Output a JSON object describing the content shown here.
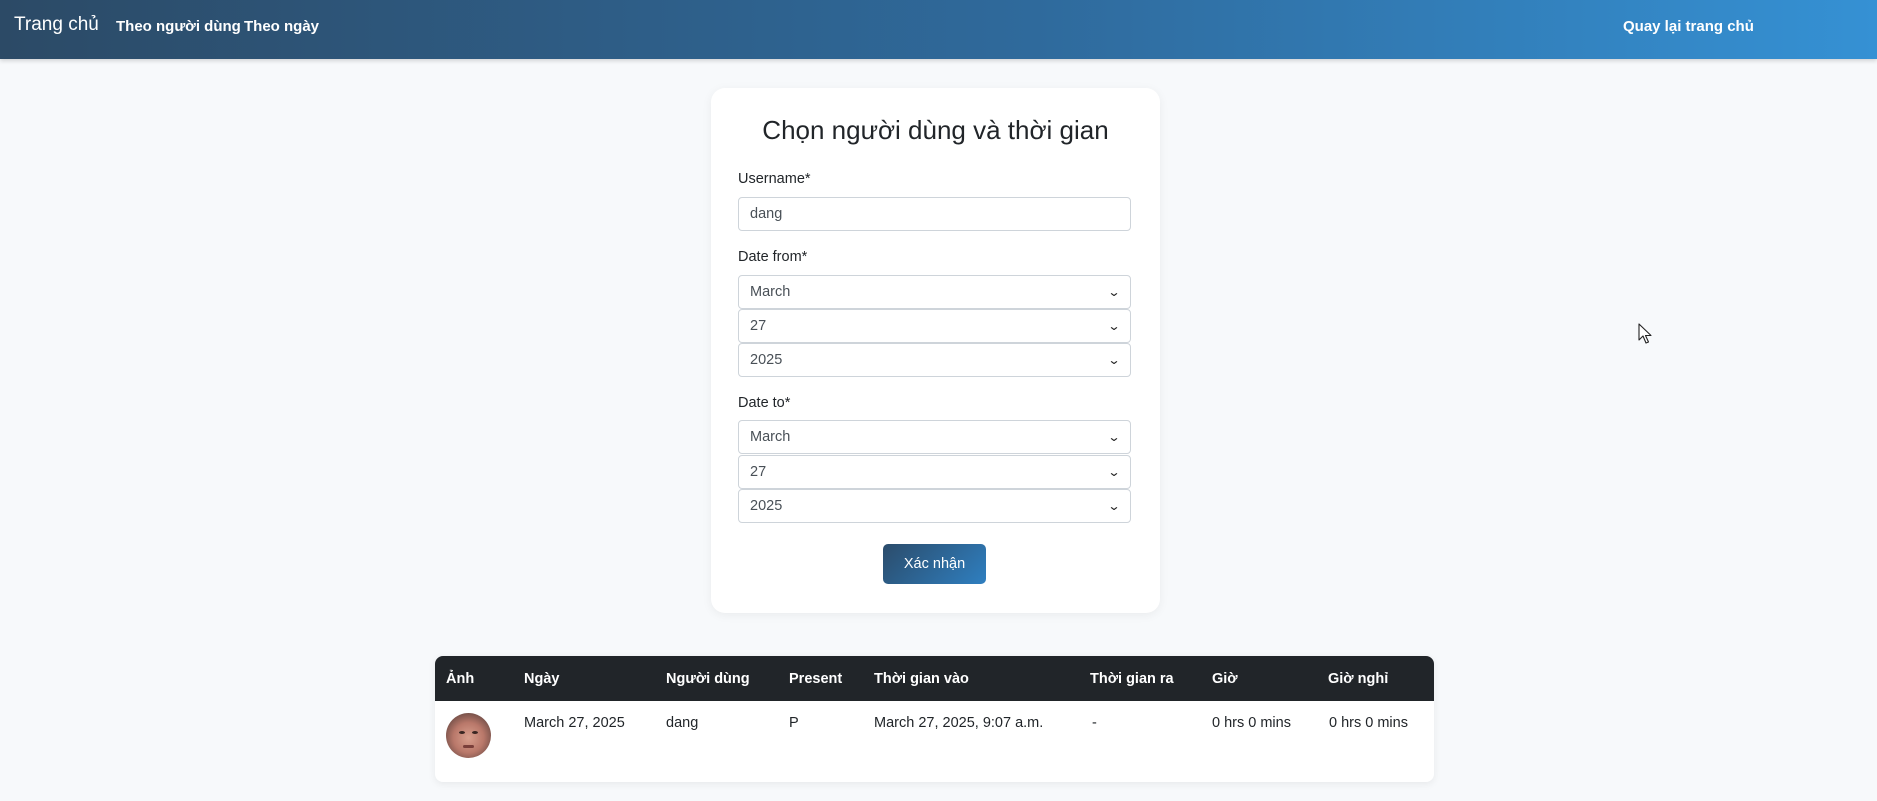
{
  "navbar": {
    "brand": "Trang chủ",
    "links": [
      "Theo người dùng",
      "Theo ngày"
    ],
    "back": "Quay lại trang chủ"
  },
  "form": {
    "title": "Chọn người dùng và thời gian",
    "username_label": "Username*",
    "username_value": "dang",
    "date_from_label": "Date from*",
    "date_from": {
      "month": "March",
      "day": "27",
      "year": "2025"
    },
    "date_to_label": "Date to*",
    "date_to": {
      "month": "March",
      "day": "27",
      "year": "2025"
    },
    "submit": "Xác nhận"
  },
  "table": {
    "headers": [
      "Ảnh",
      "Ngày",
      "Người dùng",
      "Present",
      "Thời gian vào",
      "Thời gian ra",
      "Giờ",
      "Giờ nghỉ"
    ],
    "rows": [
      {
        "date": "March 27, 2025",
        "user": "dang",
        "present": "P",
        "time_in": "March 27, 2025, 9:07 a.m.",
        "time_out": "-",
        "hours": "0 hrs 0 mins",
        "break": "0 hrs 0 mins"
      }
    ]
  },
  "icons": {
    "select_chevron": "chevron-down-icon",
    "cursor": "mouse-pointer-icon"
  }
}
